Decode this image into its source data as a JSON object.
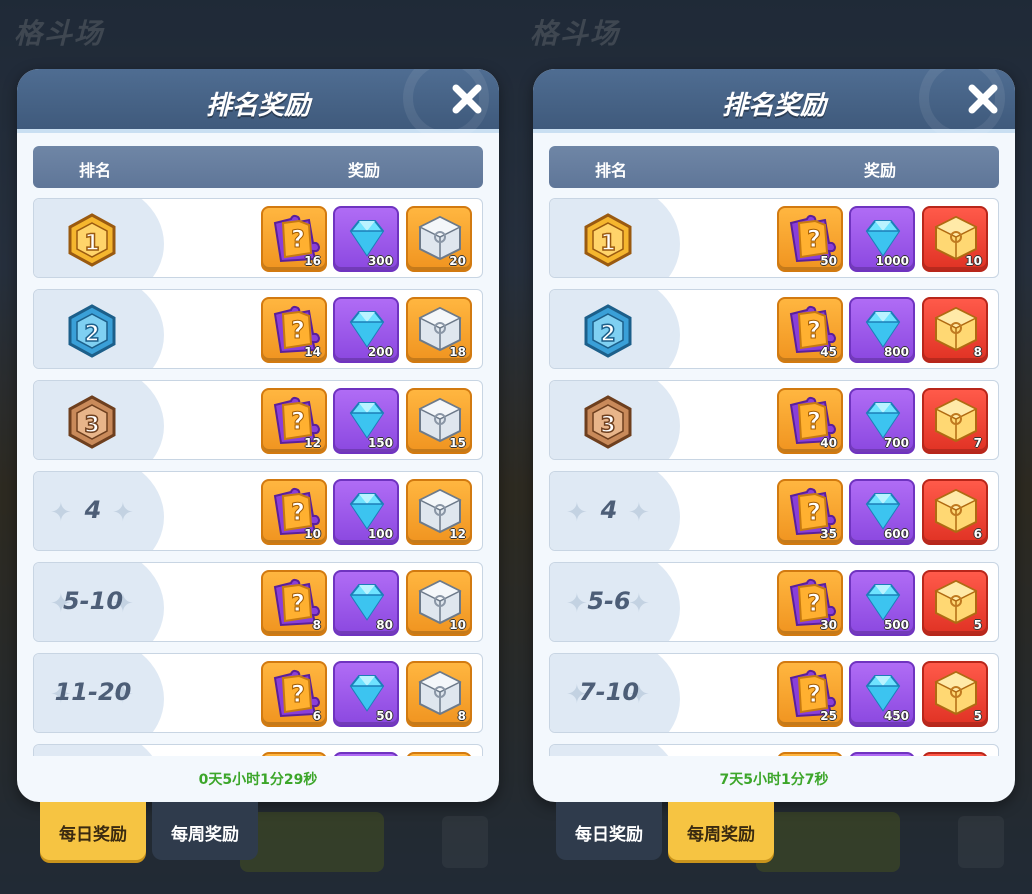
{
  "colors": {
    "header": "#4f6d92",
    "timer": "#3ca62a",
    "tab_active": "#f6c442",
    "tab_inactive": "#2f3b4c"
  },
  "screens": [
    {
      "background_title": "格斗场",
      "title": "排名奖励",
      "col_rank": "排名",
      "col_reward": "奖励",
      "timer": "0天5小时1分29秒",
      "tabs": [
        {
          "label": "每日奖励",
          "active": true
        },
        {
          "label": "每周奖励",
          "active": false
        }
      ],
      "rows": [
        {
          "rank": "1",
          "medal": "gold",
          "rewards": [
            {
              "icon": "mystery-puzzle-icon",
              "color": "orange",
              "count": "16"
            },
            {
              "icon": "diamond-icon",
              "color": "purple",
              "count": "300"
            },
            {
              "icon": "silver-cube-icon",
              "color": "orange",
              "count": "20"
            }
          ]
        },
        {
          "rank": "2",
          "medal": "silver",
          "rewards": [
            {
              "icon": "mystery-puzzle-icon",
              "color": "orange",
              "count": "14"
            },
            {
              "icon": "diamond-icon",
              "color": "purple",
              "count": "200"
            },
            {
              "icon": "silver-cube-icon",
              "color": "orange",
              "count": "18"
            }
          ]
        },
        {
          "rank": "3",
          "medal": "bronze",
          "rewards": [
            {
              "icon": "mystery-puzzle-icon",
              "color": "orange",
              "count": "12"
            },
            {
              "icon": "diamond-icon",
              "color": "purple",
              "count": "150"
            },
            {
              "icon": "silver-cube-icon",
              "color": "orange",
              "count": "15"
            }
          ]
        },
        {
          "rank": "4",
          "medal": "",
          "rewards": [
            {
              "icon": "mystery-puzzle-icon",
              "color": "orange",
              "count": "10"
            },
            {
              "icon": "diamond-icon",
              "color": "purple",
              "count": "100"
            },
            {
              "icon": "silver-cube-icon",
              "color": "orange",
              "count": "12"
            }
          ]
        },
        {
          "rank": "5-10",
          "medal": "",
          "rewards": [
            {
              "icon": "mystery-puzzle-icon",
              "color": "orange",
              "count": "8"
            },
            {
              "icon": "diamond-icon",
              "color": "purple",
              "count": "80"
            },
            {
              "icon": "silver-cube-icon",
              "color": "orange",
              "count": "10"
            }
          ]
        },
        {
          "rank": "11-20",
          "medal": "",
          "rewards": [
            {
              "icon": "mystery-puzzle-icon",
              "color": "orange",
              "count": "6"
            },
            {
              "icon": "diamond-icon",
              "color": "purple",
              "count": "50"
            },
            {
              "icon": "silver-cube-icon",
              "color": "orange",
              "count": "8"
            }
          ]
        },
        {
          "rank": "",
          "medal": "",
          "rewards": [
            {
              "icon": "mystery-puzzle-icon",
              "color": "orange",
              "count": ""
            },
            {
              "icon": "diamond-icon",
              "color": "purple",
              "count": ""
            },
            {
              "icon": "silver-cube-icon",
              "color": "orange",
              "count": ""
            }
          ]
        }
      ]
    },
    {
      "background_title": "格斗场",
      "title": "排名奖励",
      "col_rank": "排名",
      "col_reward": "奖励",
      "timer": "7天5小时1分7秒",
      "tabs": [
        {
          "label": "每日奖励",
          "active": false
        },
        {
          "label": "每周奖励",
          "active": true
        }
      ],
      "rows": [
        {
          "rank": "1",
          "medal": "gold",
          "rewards": [
            {
              "icon": "mystery-puzzle-icon",
              "color": "orange",
              "count": "50"
            },
            {
              "icon": "diamond-icon",
              "color": "purple",
              "count": "1000"
            },
            {
              "icon": "gold-cube-icon",
              "color": "red",
              "count": "10"
            }
          ]
        },
        {
          "rank": "2",
          "medal": "silver",
          "rewards": [
            {
              "icon": "mystery-puzzle-icon",
              "color": "orange",
              "count": "45"
            },
            {
              "icon": "diamond-icon",
              "color": "purple",
              "count": "800"
            },
            {
              "icon": "gold-cube-icon",
              "color": "red",
              "count": "8"
            }
          ]
        },
        {
          "rank": "3",
          "medal": "bronze",
          "rewards": [
            {
              "icon": "mystery-puzzle-icon",
              "color": "orange",
              "count": "40"
            },
            {
              "icon": "diamond-icon",
              "color": "purple",
              "count": "700"
            },
            {
              "icon": "gold-cube-icon",
              "color": "red",
              "count": "7"
            }
          ]
        },
        {
          "rank": "4",
          "medal": "",
          "rewards": [
            {
              "icon": "mystery-puzzle-icon",
              "color": "orange",
              "count": "35"
            },
            {
              "icon": "diamond-icon",
              "color": "purple",
              "count": "600"
            },
            {
              "icon": "gold-cube-icon",
              "color": "red",
              "count": "6"
            }
          ]
        },
        {
          "rank": "5-6",
          "medal": "",
          "rewards": [
            {
              "icon": "mystery-puzzle-icon",
              "color": "orange",
              "count": "30"
            },
            {
              "icon": "diamond-icon",
              "color": "purple",
              "count": "500"
            },
            {
              "icon": "gold-cube-icon",
              "color": "red",
              "count": "5"
            }
          ]
        },
        {
          "rank": "7-10",
          "medal": "",
          "rewards": [
            {
              "icon": "mystery-puzzle-icon",
              "color": "orange",
              "count": "25"
            },
            {
              "icon": "diamond-icon",
              "color": "purple",
              "count": "450"
            },
            {
              "icon": "gold-cube-icon",
              "color": "red",
              "count": "5"
            }
          ]
        },
        {
          "rank": "",
          "medal": "",
          "rewards": [
            {
              "icon": "mystery-puzzle-icon",
              "color": "orange",
              "count": ""
            },
            {
              "icon": "diamond-icon",
              "color": "purple",
              "count": ""
            },
            {
              "icon": "gold-cube-icon",
              "color": "red",
              "count": ""
            }
          ]
        }
      ]
    }
  ]
}
